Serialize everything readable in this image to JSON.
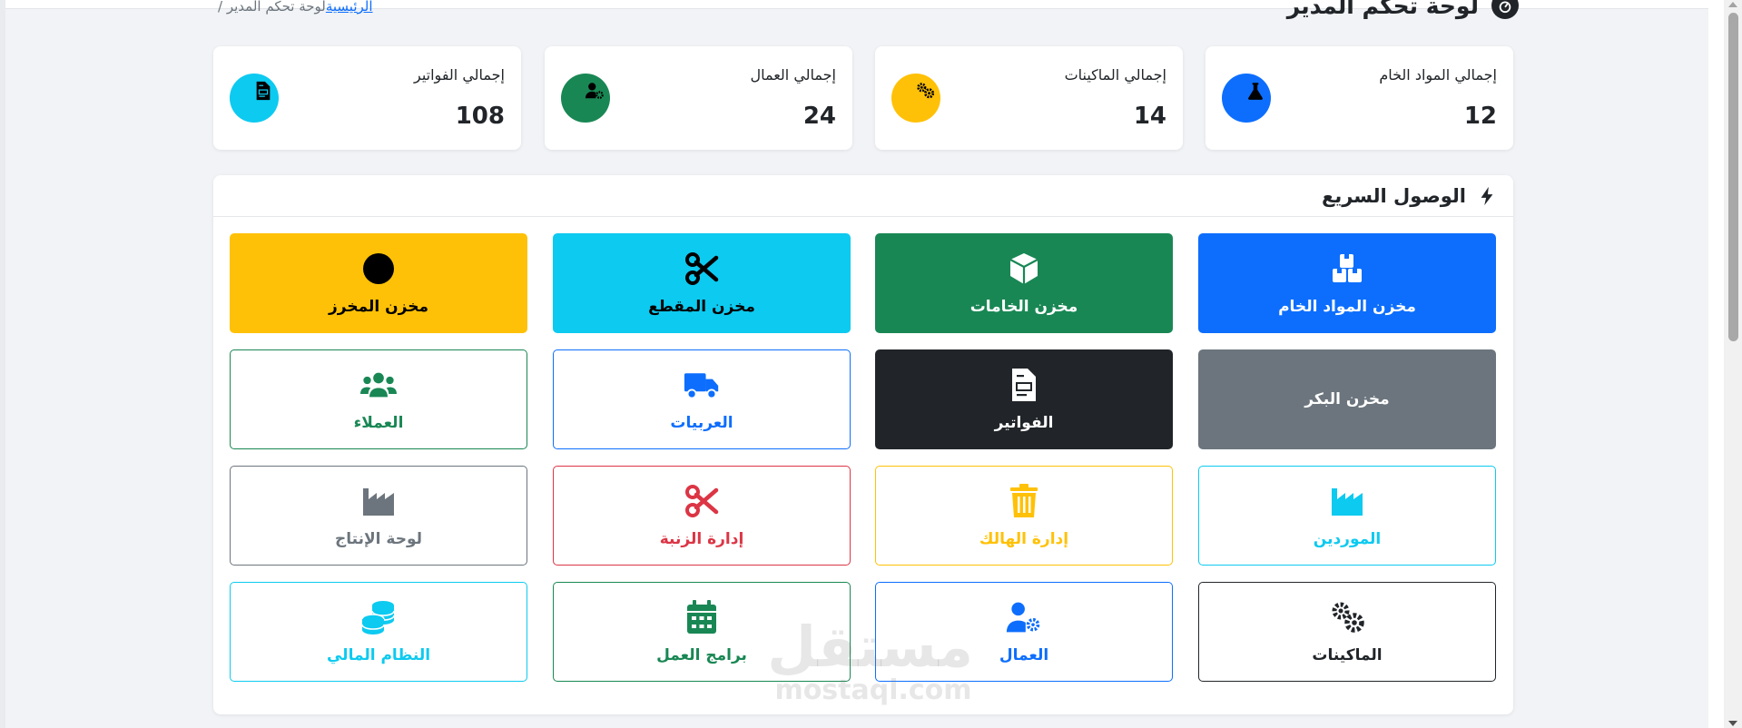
{
  "header": {
    "title": "لوحة تحكم المدير",
    "breadcrumb_home": "الرئيسية",
    "breadcrumb_current": "لوحة تحكم المدير",
    "breadcrumb_sep": " / "
  },
  "stats": [
    {
      "label": "إجمالي المواد الخام",
      "value": "12",
      "icon": "flask-icon",
      "color": "#0d6efd"
    },
    {
      "label": "إجمالي الماكينات",
      "value": "14",
      "icon": "gears-icon",
      "color": "#ffc107"
    },
    {
      "label": "إجمالي العمال",
      "value": "24",
      "icon": "user-gear-icon",
      "color": "#198754"
    },
    {
      "label": "إجمالي الفواتير",
      "value": "108",
      "icon": "invoice-icon",
      "color": "#0dcaf0"
    }
  ],
  "quick_access": {
    "title": "الوصول السريع",
    "tiles": [
      {
        "label": "مخزن المواد الخام",
        "icon": "boxes-icon"
      },
      {
        "label": "مخزن الخامات",
        "icon": "box-icon"
      },
      {
        "label": "مخزن المقطع",
        "icon": "scissors-icon"
      },
      {
        "label": "مخزن المخرز",
        "icon": "circle-icon"
      },
      {
        "label": "مخزن البكر",
        "icon": ""
      },
      {
        "label": "الفواتير",
        "icon": "invoice-icon"
      },
      {
        "label": "العربيات",
        "icon": "truck-icon"
      },
      {
        "label": "العملاء",
        "icon": "users-icon"
      },
      {
        "label": "الموردين",
        "icon": "industry-icon"
      },
      {
        "label": "إدارة الهالك",
        "icon": "trash-icon"
      },
      {
        "label": "إدارة الزنبة",
        "icon": "scissors-icon"
      },
      {
        "label": "لوحة الإنتاج",
        "icon": "industry-icon"
      },
      {
        "label": "الماكينات",
        "icon": "gears-icon"
      },
      {
        "label": "العمال",
        "icon": "user-gear-icon"
      },
      {
        "label": "برامج العمل",
        "icon": "calendar-icon"
      },
      {
        "label": "النظام المالي",
        "icon": "coins-icon"
      }
    ]
  },
  "watermark": {
    "arabic": "مستقل",
    "latin": "mostaql.com"
  }
}
